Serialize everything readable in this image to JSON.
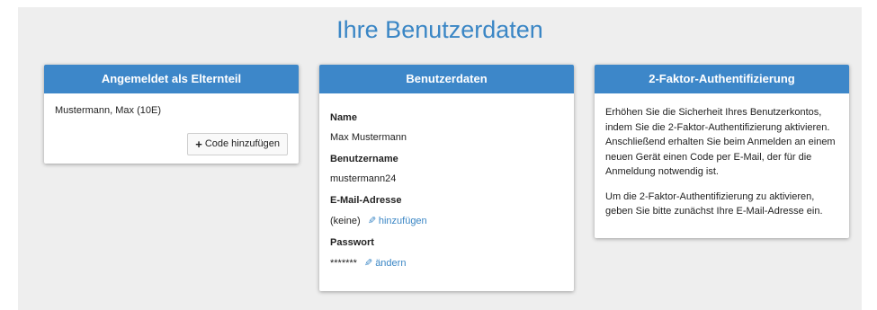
{
  "page": {
    "title": "Ihre Benutzerdaten"
  },
  "parent_card": {
    "header": "Angemeldet als Elternteil",
    "child": "Mustermann, Max (10E)",
    "add_code_label": "Code hinzufügen",
    "add_code_icon": "plus-icon"
  },
  "user_card": {
    "header": "Benutzerdaten",
    "name_label": "Name",
    "name_value": "Max Mustermann",
    "username_label": "Benutzername",
    "username_value": "mustermann24",
    "email_label": "E-Mail-Adresse",
    "email_value": "(keine)",
    "email_action": "hinzufügen",
    "password_label": "Passwort",
    "password_value": "*******",
    "password_action": "ändern",
    "action_icon": "pencil-icon"
  },
  "twofa_card": {
    "header": "2-Faktor-Authentifizierung",
    "paragraph1": "Erhöhen Sie die Sicherheit Ihres Benutzerkontos, indem Sie die 2-Faktor-Authentifizierung aktivieren. Anschließend erhalten Sie beim Anmelden an einem neuen Gerät einen Code per E-Mail, der für die Anmeldung notwendig ist.",
    "paragraph2": "Um die 2-Faktor-Authentifizierung zu aktivieren, geben Sie bitte zunächst Ihre E-Mail-Adresse ein."
  },
  "colors": {
    "accent": "#3d87c9",
    "link": "#3a86c5",
    "background": "#eeeeee"
  }
}
